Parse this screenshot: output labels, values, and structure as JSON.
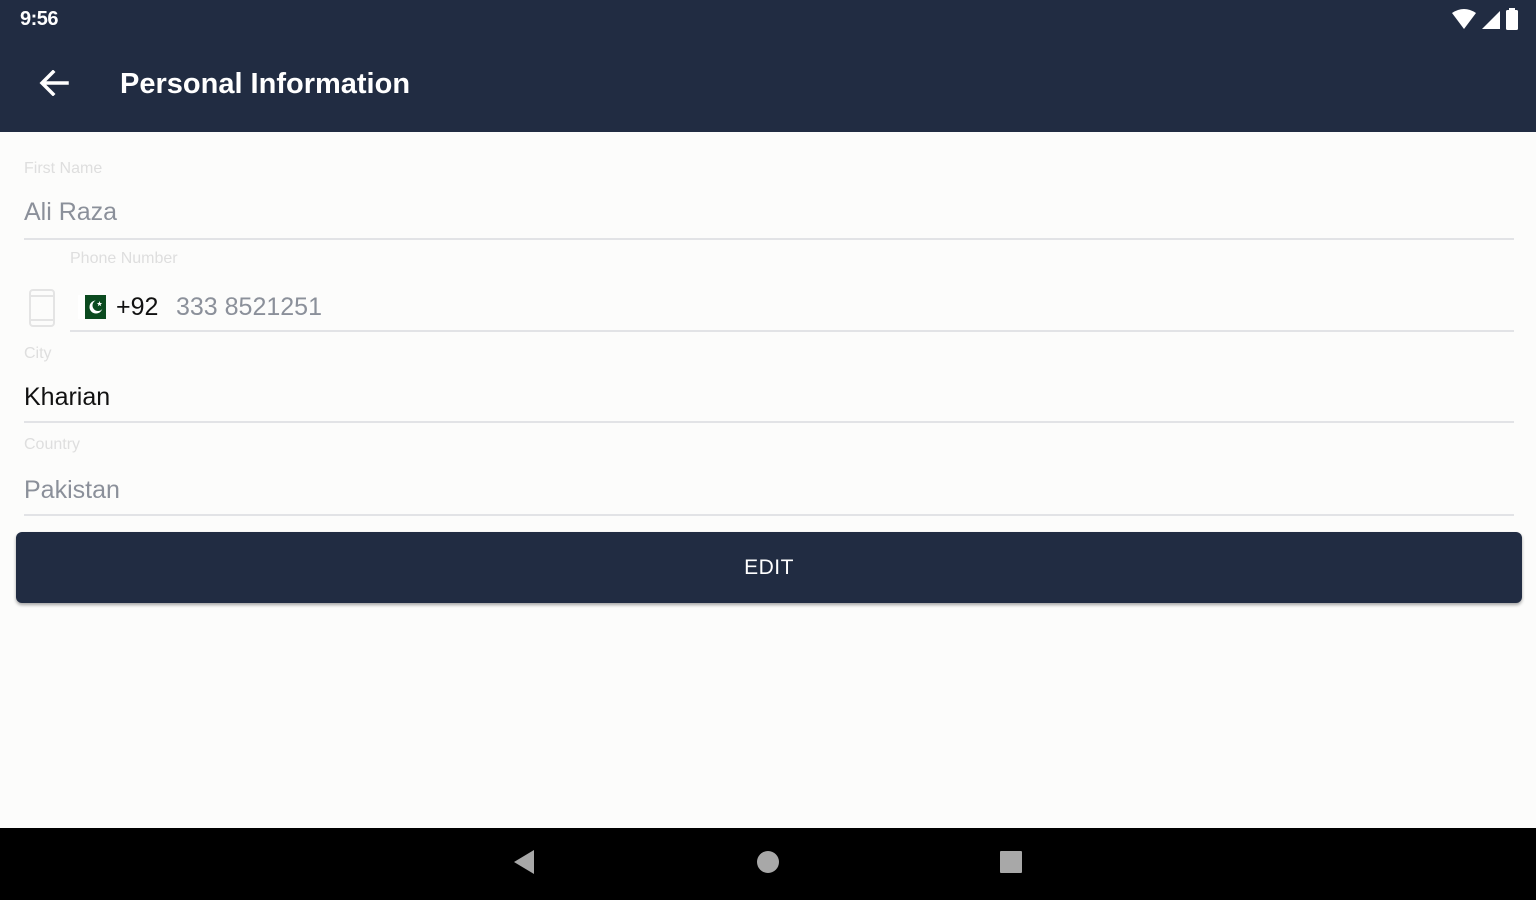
{
  "status_bar": {
    "time": "9:56",
    "icons": [
      "wifi-icon",
      "cell-signal-icon",
      "battery-icon"
    ]
  },
  "app_bar": {
    "title": "Personal Information",
    "back_icon": "arrow-left-icon"
  },
  "form": {
    "first_name": {
      "label": "First Name",
      "value": "Ali Raza"
    },
    "phone": {
      "label": "Phone Number",
      "country_code": "+92",
      "number": "333 8521251",
      "flag": "pakistan-flag-icon"
    },
    "city": {
      "label": "City",
      "value": "Kharian"
    },
    "country": {
      "label": "Country",
      "value": "Pakistan"
    }
  },
  "edit_button": {
    "label": "EDIT"
  },
  "nav_bar": {
    "icons": [
      "back-triangle-icon",
      "home-circle-icon",
      "recents-square-icon"
    ]
  },
  "colors": {
    "primary": "#212c42",
    "background": "#fcfcfb",
    "flag_green": "#0b4a1f"
  }
}
